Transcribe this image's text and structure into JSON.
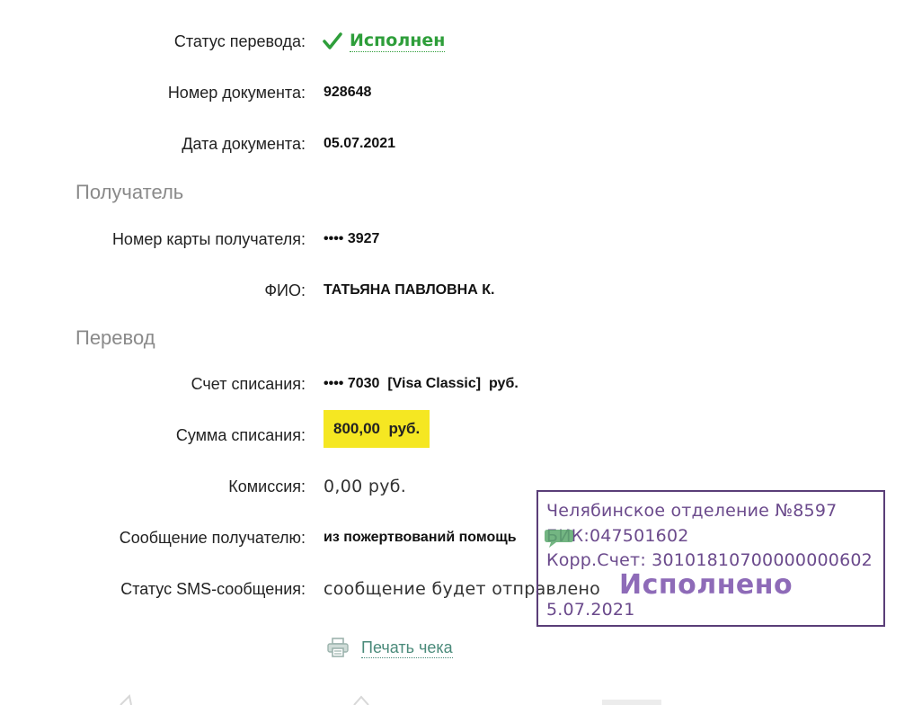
{
  "status": {
    "label": "Статус перевода:",
    "value": "Исполнен",
    "color": "#2e9e3a",
    "icon": "check-icon"
  },
  "doc_number": {
    "label": "Номер документа:",
    "value": "928648"
  },
  "doc_date": {
    "label": "Дата документа:",
    "value": "05.07.2021"
  },
  "recipient_section": "Получатель",
  "card": {
    "label": "Номер карты получателя:",
    "value": "•••• 3927"
  },
  "name": {
    "label": "ФИО:",
    "value": "ТАТЬЯНА ПАВЛОВНА К."
  },
  "transfer_section": "Перевод",
  "account": {
    "label": "Счет списания:",
    "value": "•••• 7030  [Visa Classic]  руб."
  },
  "amount": {
    "label": "Сумма списания:",
    "value": "800,00  руб.",
    "highlight": "#f5e722"
  },
  "fee": {
    "label": "Комиссия:",
    "value": "0,00 руб."
  },
  "message": {
    "label": "Сообщение получателю:",
    "value": "из пожертвований помощь"
  },
  "sms": {
    "label": "Статус SMS-сообщения:",
    "value": "сообщение будет отправлено"
  },
  "print": {
    "label": "Печать чека",
    "icon": "printer-icon"
  },
  "stamp": {
    "line1": "Челябинское отделение №8597",
    "line2": "БИК:047501602",
    "line3": "Корр.Счет: 30101810700000000602",
    "big": "Исполнено",
    "date": "5.07.2021",
    "color": "#6b4a8c"
  }
}
